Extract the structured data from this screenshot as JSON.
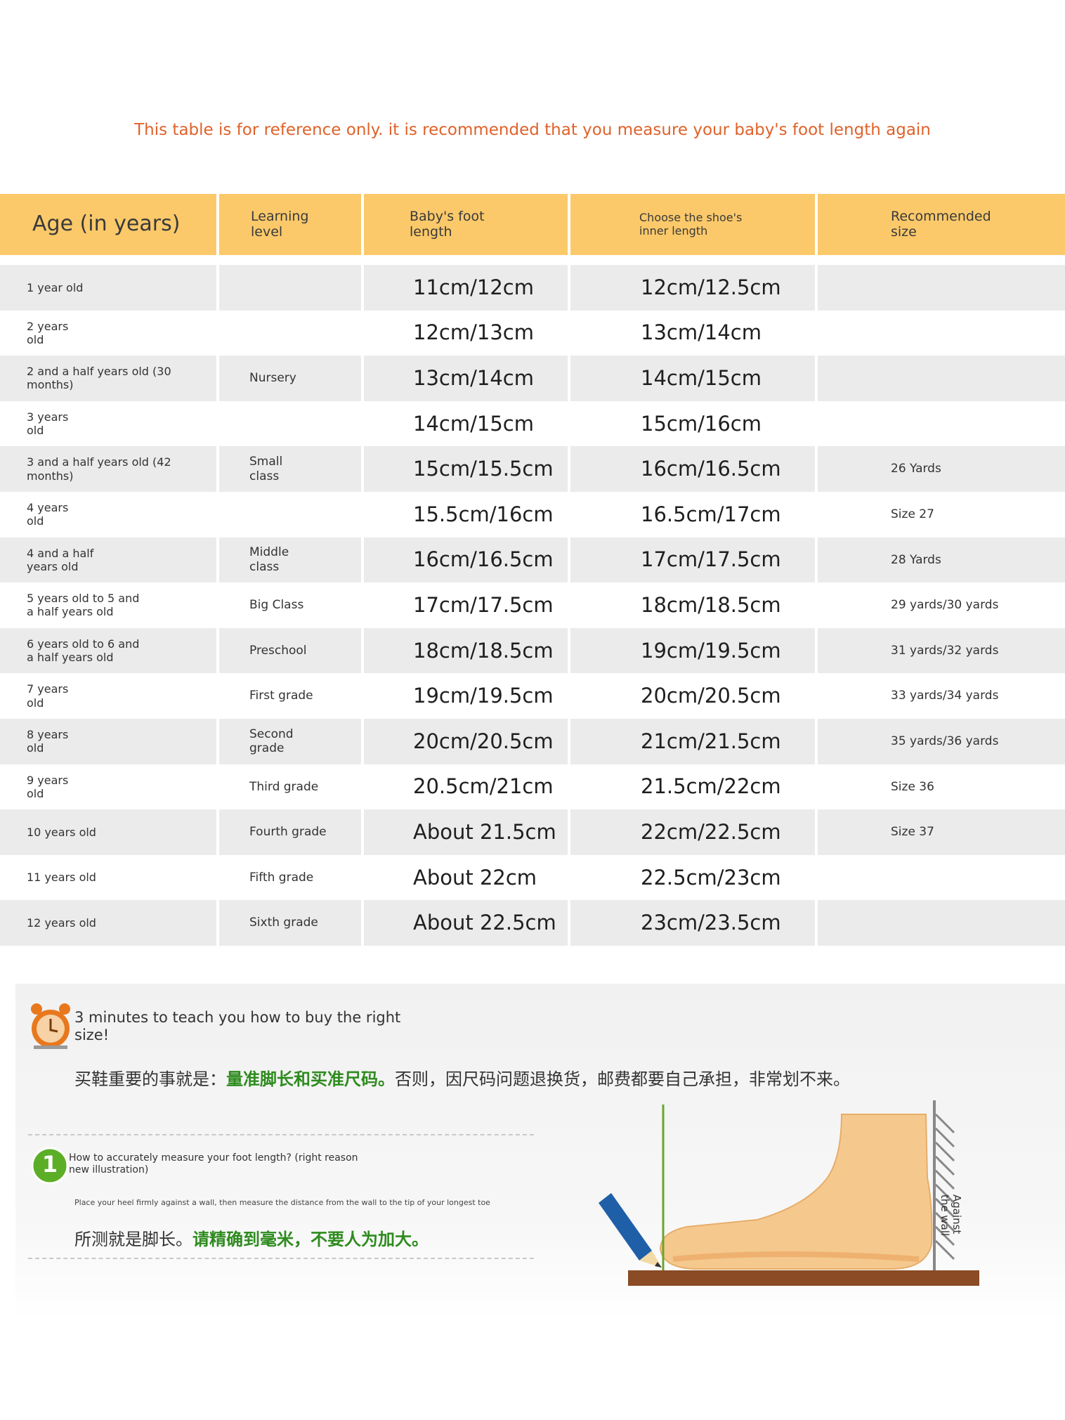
{
  "note": "This table is for reference only. it is recommended that you measure your baby's foot length again",
  "table": {
    "headers": [
      "Age (in years)",
      "Learning\nlevel",
      "Baby's foot\nlength",
      "Choose the shoe's\ninner length",
      "Recommended\nsize"
    ],
    "rows": [
      {
        "age": "1 year old",
        "level": "",
        "foot": "11cm/12cm",
        "inner": "12cm/12.5cm",
        "size": ""
      },
      {
        "age": "2 years\nold",
        "level": "",
        "foot": "12cm/13cm",
        "inner": "13cm/14cm",
        "size": ""
      },
      {
        "age": "2 and a half years old (30\nmonths)",
        "level": "Nursery",
        "foot": "13cm/14cm",
        "inner": "14cm/15cm",
        "size": ""
      },
      {
        "age": "3 years\nold",
        "level": "",
        "foot": "14cm/15cm",
        "inner": "15cm/16cm",
        "size": ""
      },
      {
        "age": "3 and a half years old (42\nmonths)",
        "level": "Small\nclass",
        "foot": "15cm/15.5cm",
        "inner": "16cm/16.5cm",
        "size": "26 Yards"
      },
      {
        "age": "4 years\nold",
        "level": "",
        "foot": "15.5cm/16cm",
        "inner": "16.5cm/17cm",
        "size": "Size 27"
      },
      {
        "age": "4 and a half\nyears old",
        "level": "Middle\nclass",
        "foot": "16cm/16.5cm",
        "inner": "17cm/17.5cm",
        "size": "28 Yards"
      },
      {
        "age": "5 years old to 5 and\na half years old",
        "level": "Big Class",
        "foot": "17cm/17.5cm",
        "inner": "18cm/18.5cm",
        "size": "29 yards/30 yards"
      },
      {
        "age": "6 years old to 6 and\na half years old",
        "level": "Preschool",
        "foot": "18cm/18.5cm",
        "inner": "19cm/19.5cm",
        "size": "31 yards/32 yards"
      },
      {
        "age": "7 years\nold",
        "level": "First grade",
        "foot": "19cm/19.5cm",
        "inner": "20cm/20.5cm",
        "size": "33 yards/34 yards"
      },
      {
        "age": "8 years\nold",
        "level": "Second\ngrade",
        "foot": "20cm/20.5cm",
        "inner": "21cm/21.5cm",
        "size": "35 yards/36 yards"
      },
      {
        "age": "9 years\nold",
        "level": "Third grade",
        "foot": "20.5cm/21cm",
        "inner": "21.5cm/22cm",
        "size": "Size 36"
      },
      {
        "age": "10 years old",
        "level": "Fourth grade",
        "foot": "About 21.5cm",
        "inner": "22cm/22.5cm",
        "size": "Size 37"
      },
      {
        "age": "11 years old",
        "level": "Fifth grade",
        "foot": "About 22cm",
        "inner": "22.5cm/23cm",
        "size": ""
      },
      {
        "age": "12 years old",
        "level": "Sixth grade",
        "foot": "About 22.5cm",
        "inner": "23cm/23.5cm",
        "size": ""
      }
    ]
  },
  "guide": {
    "title": "3 minutes to teach you how to buy the right size!",
    "cn_intro_plain": "买鞋重要的事就是：",
    "cn_intro_green": "量准脚长和买准尺码。",
    "cn_intro_rest": "否则，因尺码问题退换货，邮费都要自己承担，非常划不来。",
    "step_number": "1",
    "step_question": "How to accurately measure your foot length? (right reason new illustration)",
    "step_desc": "Place your heel firmly against a wall, then measure the distance from the wall to the tip of your longest toe",
    "step_cn_plain": "所测就是脚长。",
    "step_cn_green": "请精确到毫米，不要人为加大。",
    "wall_label": "Against\nthe wall"
  }
}
